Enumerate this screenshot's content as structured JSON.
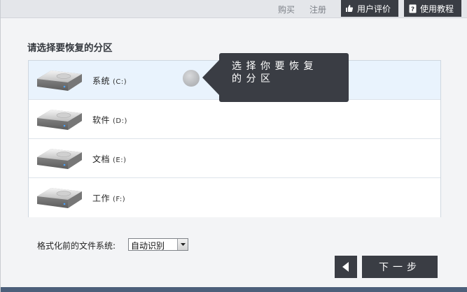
{
  "topbar": {
    "links": [
      "购买",
      "注册"
    ],
    "review_label": "用户评价",
    "tutorial_label": "使用教程"
  },
  "section_title": "请选择要恢复的分区",
  "partitions": [
    {
      "name": "系统",
      "drive": "(C:)"
    },
    {
      "name": "软件",
      "drive": "(D:)"
    },
    {
      "name": "文档",
      "drive": "(E:)"
    },
    {
      "name": "工作",
      "drive": "(F:)"
    }
  ],
  "tooltip": {
    "line1": "选择你要恢复",
    "line2": "的分区"
  },
  "filesystem": {
    "label": "格式化前的文件系统:",
    "selected": "自动识别"
  },
  "nav": {
    "next_label": "下一步"
  },
  "colors": {
    "dark": "#3a3d44",
    "selected_row": "#e9f3fd",
    "bottom_strip": "#4c5f7a"
  }
}
